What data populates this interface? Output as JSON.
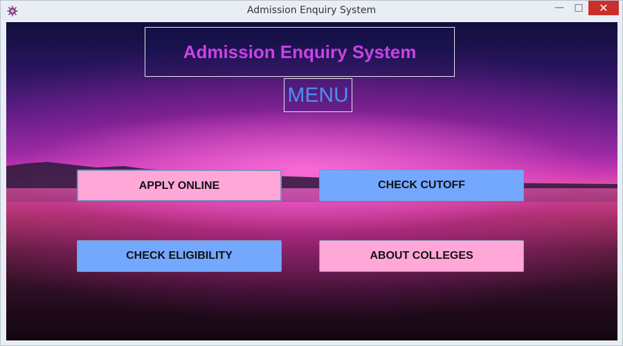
{
  "window": {
    "title": "Admission Enquiry System",
    "controls": {
      "minimize": "—",
      "maximize": "□",
      "close": "✕"
    }
  },
  "header": {
    "title": "Admission Enquiry System"
  },
  "menu": {
    "label": "MENU"
  },
  "buttons": {
    "apply_online": "APPLY ONLINE",
    "check_cutoff": "CHECK CUTOFF",
    "check_eligibility": "CHECK ELIGIBILITY",
    "about_colleges": "ABOUT COLLEGES"
  },
  "colors": {
    "header_text": "#c843e8",
    "menu_text": "#4f8ff3",
    "pink_button": "#ffa8d8",
    "blue_button": "#74a8ff",
    "close_button": "#c9302c"
  },
  "icons": {
    "app": "app-icon"
  }
}
